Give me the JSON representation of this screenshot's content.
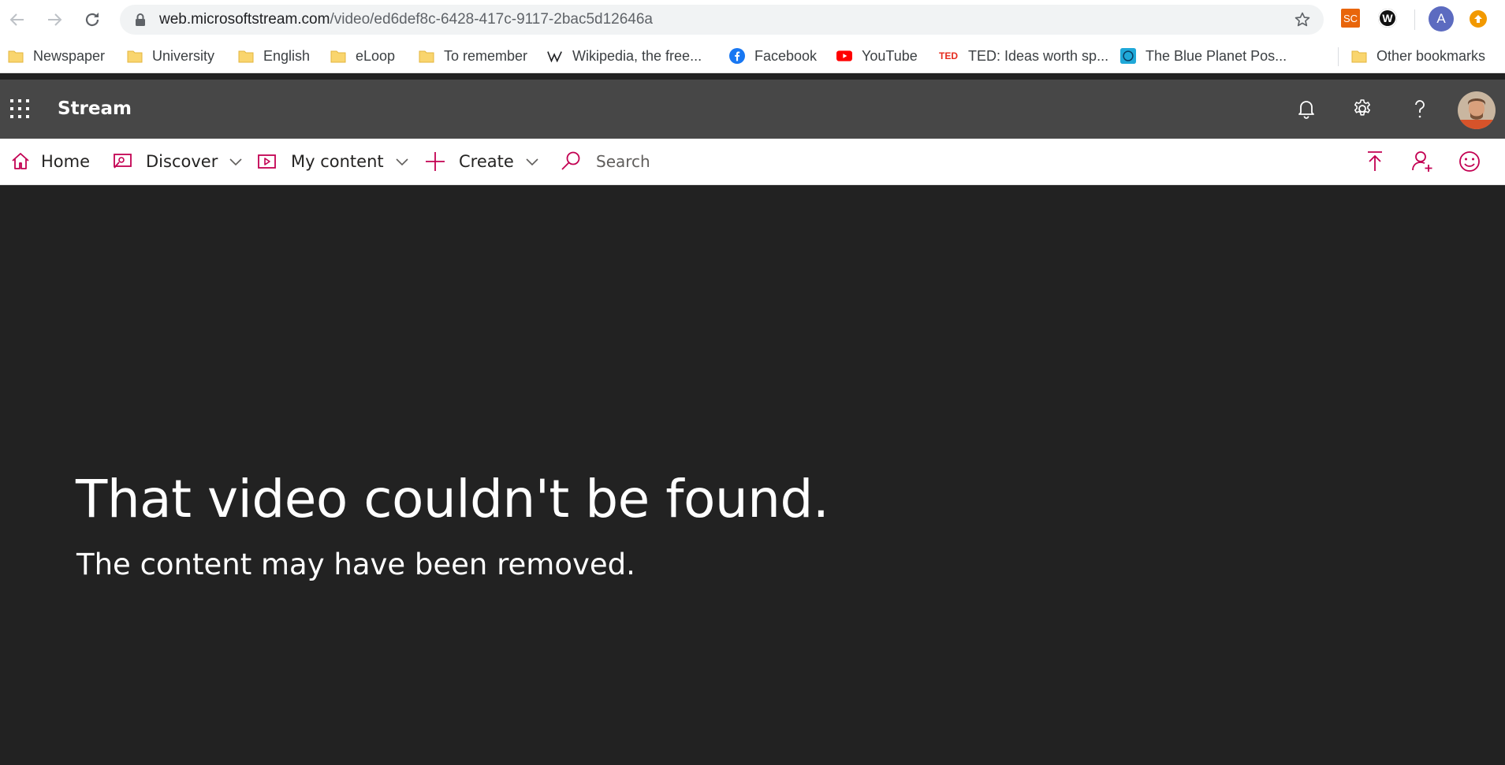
{
  "browser": {
    "url_domain": "web.microsoftstream.com",
    "url_path": "/video/ed6def8c-6428-417c-9117-2bac5d12646a",
    "extensions": {
      "sc_label": "SC",
      "w_label": "W",
      "profile_initial": "A"
    },
    "bookmarks": [
      {
        "label": "Newspaper",
        "icon": "folder-icon"
      },
      {
        "label": "University",
        "icon": "folder-icon"
      },
      {
        "label": "English",
        "icon": "folder-icon"
      },
      {
        "label": "eLoop",
        "icon": "folder-icon"
      },
      {
        "label": "To remember",
        "icon": "folder-icon"
      },
      {
        "label": "Wikipedia, the free...",
        "icon": "wikipedia-icon"
      },
      {
        "label": "Facebook",
        "icon": "facebook-icon"
      },
      {
        "label": "YouTube",
        "icon": "youtube-icon"
      },
      {
        "label": "TED: Ideas worth sp...",
        "icon": "ted-icon"
      },
      {
        "label": "The Blue Planet Pos...",
        "icon": "blue-planet-icon"
      }
    ],
    "other_bookmarks": "Other bookmarks",
    "ted_logo": "TED"
  },
  "app": {
    "title": "Stream",
    "nav": {
      "home": "Home",
      "discover": "Discover",
      "my_content": "My content",
      "create": "Create",
      "search_placeholder": "Search"
    }
  },
  "error": {
    "title": "That video couldn't be found.",
    "subtitle": "The content may have been removed."
  },
  "colors": {
    "accent": "#c30052",
    "header_bg": "#474747",
    "content_bg": "#222222",
    "folder": "#f9d56e"
  }
}
